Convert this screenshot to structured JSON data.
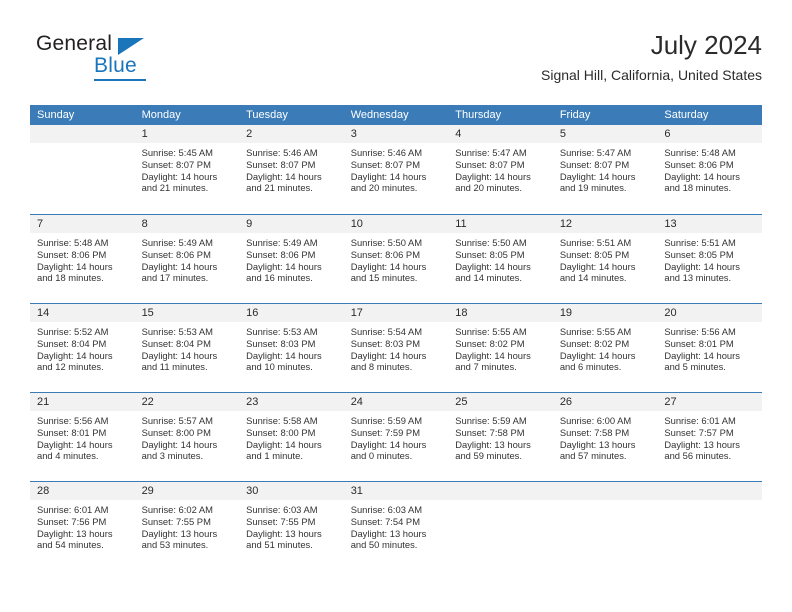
{
  "brand": {
    "name_part1": "General",
    "name_part2": "Blue"
  },
  "header": {
    "title": "July 2024",
    "subtitle": "Signal Hill, California, United States"
  },
  "colors": {
    "header_blue": "#3b7cb8",
    "brand_blue": "#1b75bb",
    "date_strip": "#f2f2f2",
    "text": "#333333"
  },
  "weekdays": [
    "Sunday",
    "Monday",
    "Tuesday",
    "Wednesday",
    "Thursday",
    "Friday",
    "Saturday"
  ],
  "weeks": [
    [
      {
        "date": "",
        "sunrise": "",
        "sunset": "",
        "daylight_line1": "",
        "daylight_line2": ""
      },
      {
        "date": "1",
        "sunrise": "Sunrise: 5:45 AM",
        "sunset": "Sunset: 8:07 PM",
        "daylight_line1": "Daylight: 14 hours",
        "daylight_line2": "and 21 minutes."
      },
      {
        "date": "2",
        "sunrise": "Sunrise: 5:46 AM",
        "sunset": "Sunset: 8:07 PM",
        "daylight_line1": "Daylight: 14 hours",
        "daylight_line2": "and 21 minutes."
      },
      {
        "date": "3",
        "sunrise": "Sunrise: 5:46 AM",
        "sunset": "Sunset: 8:07 PM",
        "daylight_line1": "Daylight: 14 hours",
        "daylight_line2": "and 20 minutes."
      },
      {
        "date": "4",
        "sunrise": "Sunrise: 5:47 AM",
        "sunset": "Sunset: 8:07 PM",
        "daylight_line1": "Daylight: 14 hours",
        "daylight_line2": "and 20 minutes."
      },
      {
        "date": "5",
        "sunrise": "Sunrise: 5:47 AM",
        "sunset": "Sunset: 8:07 PM",
        "daylight_line1": "Daylight: 14 hours",
        "daylight_line2": "and 19 minutes."
      },
      {
        "date": "6",
        "sunrise": "Sunrise: 5:48 AM",
        "sunset": "Sunset: 8:06 PM",
        "daylight_line1": "Daylight: 14 hours",
        "daylight_line2": "and 18 minutes."
      }
    ],
    [
      {
        "date": "7",
        "sunrise": "Sunrise: 5:48 AM",
        "sunset": "Sunset: 8:06 PM",
        "daylight_line1": "Daylight: 14 hours",
        "daylight_line2": "and 18 minutes."
      },
      {
        "date": "8",
        "sunrise": "Sunrise: 5:49 AM",
        "sunset": "Sunset: 8:06 PM",
        "daylight_line1": "Daylight: 14 hours",
        "daylight_line2": "and 17 minutes."
      },
      {
        "date": "9",
        "sunrise": "Sunrise: 5:49 AM",
        "sunset": "Sunset: 8:06 PM",
        "daylight_line1": "Daylight: 14 hours",
        "daylight_line2": "and 16 minutes."
      },
      {
        "date": "10",
        "sunrise": "Sunrise: 5:50 AM",
        "sunset": "Sunset: 8:06 PM",
        "daylight_line1": "Daylight: 14 hours",
        "daylight_line2": "and 15 minutes."
      },
      {
        "date": "11",
        "sunrise": "Sunrise: 5:50 AM",
        "sunset": "Sunset: 8:05 PM",
        "daylight_line1": "Daylight: 14 hours",
        "daylight_line2": "and 14 minutes."
      },
      {
        "date": "12",
        "sunrise": "Sunrise: 5:51 AM",
        "sunset": "Sunset: 8:05 PM",
        "daylight_line1": "Daylight: 14 hours",
        "daylight_line2": "and 14 minutes."
      },
      {
        "date": "13",
        "sunrise": "Sunrise: 5:51 AM",
        "sunset": "Sunset: 8:05 PM",
        "daylight_line1": "Daylight: 14 hours",
        "daylight_line2": "and 13 minutes."
      }
    ],
    [
      {
        "date": "14",
        "sunrise": "Sunrise: 5:52 AM",
        "sunset": "Sunset: 8:04 PM",
        "daylight_line1": "Daylight: 14 hours",
        "daylight_line2": "and 12 minutes."
      },
      {
        "date": "15",
        "sunrise": "Sunrise: 5:53 AM",
        "sunset": "Sunset: 8:04 PM",
        "daylight_line1": "Daylight: 14 hours",
        "daylight_line2": "and 11 minutes."
      },
      {
        "date": "16",
        "sunrise": "Sunrise: 5:53 AM",
        "sunset": "Sunset: 8:03 PM",
        "daylight_line1": "Daylight: 14 hours",
        "daylight_line2": "and 10 minutes."
      },
      {
        "date": "17",
        "sunrise": "Sunrise: 5:54 AM",
        "sunset": "Sunset: 8:03 PM",
        "daylight_line1": "Daylight: 14 hours",
        "daylight_line2": "and 8 minutes."
      },
      {
        "date": "18",
        "sunrise": "Sunrise: 5:55 AM",
        "sunset": "Sunset: 8:02 PM",
        "daylight_line1": "Daylight: 14 hours",
        "daylight_line2": "and 7 minutes."
      },
      {
        "date": "19",
        "sunrise": "Sunrise: 5:55 AM",
        "sunset": "Sunset: 8:02 PM",
        "daylight_line1": "Daylight: 14 hours",
        "daylight_line2": "and 6 minutes."
      },
      {
        "date": "20",
        "sunrise": "Sunrise: 5:56 AM",
        "sunset": "Sunset: 8:01 PM",
        "daylight_line1": "Daylight: 14 hours",
        "daylight_line2": "and 5 minutes."
      }
    ],
    [
      {
        "date": "21",
        "sunrise": "Sunrise: 5:56 AM",
        "sunset": "Sunset: 8:01 PM",
        "daylight_line1": "Daylight: 14 hours",
        "daylight_line2": "and 4 minutes."
      },
      {
        "date": "22",
        "sunrise": "Sunrise: 5:57 AM",
        "sunset": "Sunset: 8:00 PM",
        "daylight_line1": "Daylight: 14 hours",
        "daylight_line2": "and 3 minutes."
      },
      {
        "date": "23",
        "sunrise": "Sunrise: 5:58 AM",
        "sunset": "Sunset: 8:00 PM",
        "daylight_line1": "Daylight: 14 hours",
        "daylight_line2": "and 1 minute."
      },
      {
        "date": "24",
        "sunrise": "Sunrise: 5:59 AM",
        "sunset": "Sunset: 7:59 PM",
        "daylight_line1": "Daylight: 14 hours",
        "daylight_line2": "and 0 minutes."
      },
      {
        "date": "25",
        "sunrise": "Sunrise: 5:59 AM",
        "sunset": "Sunset: 7:58 PM",
        "daylight_line1": "Daylight: 13 hours",
        "daylight_line2": "and 59 minutes."
      },
      {
        "date": "26",
        "sunrise": "Sunrise: 6:00 AM",
        "sunset": "Sunset: 7:58 PM",
        "daylight_line1": "Daylight: 13 hours",
        "daylight_line2": "and 57 minutes."
      },
      {
        "date": "27",
        "sunrise": "Sunrise: 6:01 AM",
        "sunset": "Sunset: 7:57 PM",
        "daylight_line1": "Daylight: 13 hours",
        "daylight_line2": "and 56 minutes."
      }
    ],
    [
      {
        "date": "28",
        "sunrise": "Sunrise: 6:01 AM",
        "sunset": "Sunset: 7:56 PM",
        "daylight_line1": "Daylight: 13 hours",
        "daylight_line2": "and 54 minutes."
      },
      {
        "date": "29",
        "sunrise": "Sunrise: 6:02 AM",
        "sunset": "Sunset: 7:55 PM",
        "daylight_line1": "Daylight: 13 hours",
        "daylight_line2": "and 53 minutes."
      },
      {
        "date": "30",
        "sunrise": "Sunrise: 6:03 AM",
        "sunset": "Sunset: 7:55 PM",
        "daylight_line1": "Daylight: 13 hours",
        "daylight_line2": "and 51 minutes."
      },
      {
        "date": "31",
        "sunrise": "Sunrise: 6:03 AM",
        "sunset": "Sunset: 7:54 PM",
        "daylight_line1": "Daylight: 13 hours",
        "daylight_line2": "and 50 minutes."
      },
      {
        "date": "",
        "sunrise": "",
        "sunset": "",
        "daylight_line1": "",
        "daylight_line2": ""
      },
      {
        "date": "",
        "sunrise": "",
        "sunset": "",
        "daylight_line1": "",
        "daylight_line2": ""
      },
      {
        "date": "",
        "sunrise": "",
        "sunset": "",
        "daylight_line1": "",
        "daylight_line2": ""
      }
    ]
  ]
}
